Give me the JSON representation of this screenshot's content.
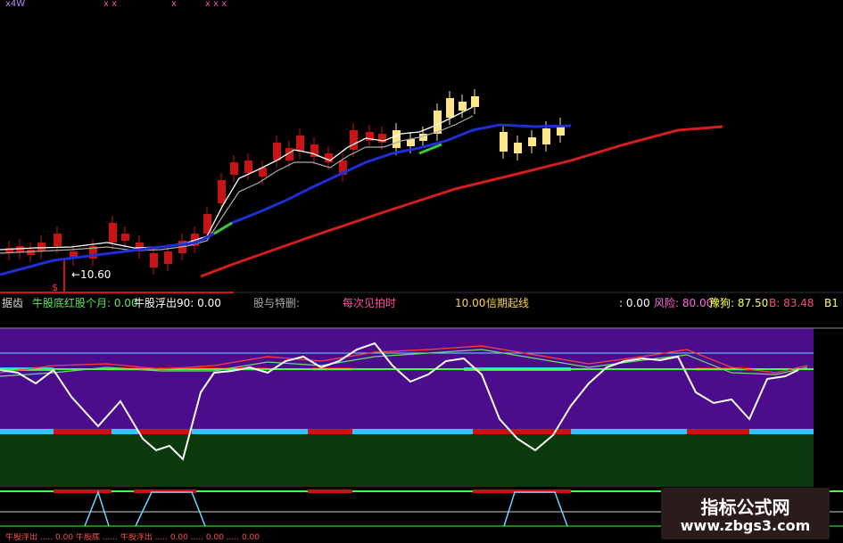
{
  "header": {
    "segments": [
      {
        "text": "x4W"
      },
      {
        "text": "x x"
      },
      {
        "text": "x"
      },
      {
        "text": "x x x"
      }
    ]
  },
  "price_annotation": {
    "label": "←10.60",
    "marker": "$"
  },
  "status": {
    "left_tag": "据齿",
    "niu_gu_di_hong": "牛股底红股个月: 0.00",
    "niu_gu_fu_chu": "牛股浮出90: 0.00",
    "gu_xi_te": "股与特删:",
    "mid_label": "每次见拍时",
    "mid_value": "10.00",
    "tag_label": "信期起线",
    "value_a": ": 0.00",
    "feng_xian": "风险: 80.00",
    "zhuo_gou": "豫狗: 87.50",
    "b_value": "B: 83.48",
    "b1_value": "B1"
  },
  "bottom_row": {
    "text": "牛股浮出 ..... 0.00 牛股底 ...... 牛股浮出 ..... 0.00 ..... 0.00 ..... 0.00"
  },
  "watermark": {
    "title": "指标公式网",
    "url": "www.zbgs3.com"
  },
  "colors": {
    "background": "#000000",
    "purple_panel": "#4b0d8c",
    "green_panel": "#0c3a0c",
    "up_candle": "#c81414",
    "yellow_candle": "#ffe58a",
    "ma_blue": "#1e2fd6",
    "ma_red": "#d31e1e",
    "cyan_band": "#36c3ff",
    "red_band": "#d01010",
    "white_line": "#ffffff"
  }
}
